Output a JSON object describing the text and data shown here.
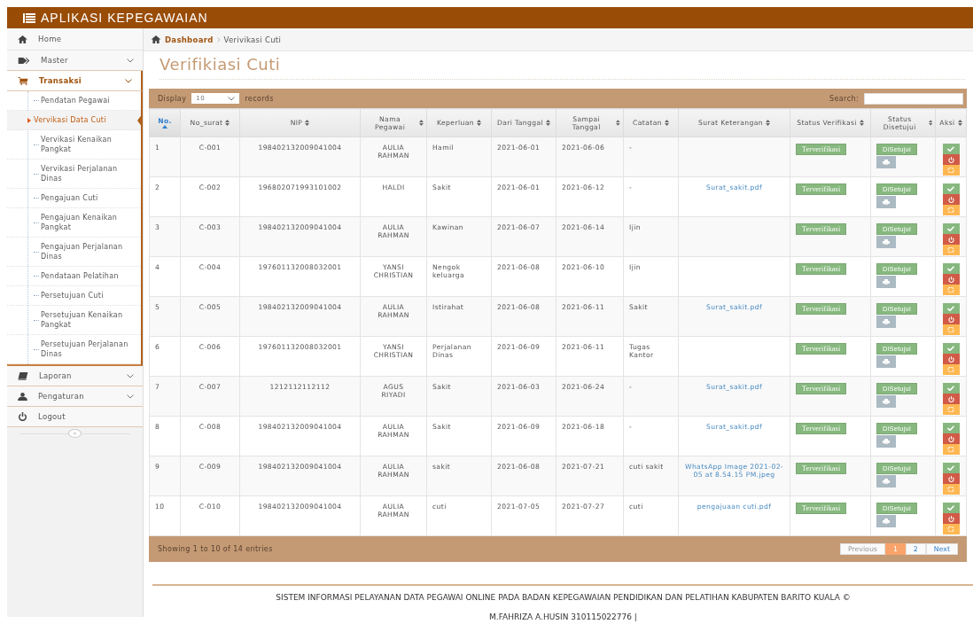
{
  "header": {
    "title": "APLIKASI KEPEGAWAIAN"
  },
  "sidebar": {
    "items": [
      {
        "label": "Home",
        "kind": "link"
      },
      {
        "label": "Master",
        "kind": "menu",
        "expanded": false
      },
      {
        "label": "Transaksi",
        "kind": "menu",
        "expanded": true,
        "children": [
          {
            "label": "Pendatan Pegawai",
            "selected": false
          },
          {
            "label": "Vervikasi Data Cuti",
            "selected": true
          },
          {
            "label": "Vervikasi Kenaikan Pangkat",
            "selected": false
          },
          {
            "label": "Vervikasi Perjalanan Dinas",
            "selected": false
          },
          {
            "label": "Pengajuan Cuti",
            "selected": false
          },
          {
            "label": "Pengajuan Kenaikan Pangkat",
            "selected": false
          },
          {
            "label": "Pengajuan Perjalanan Dinas",
            "selected": false
          },
          {
            "label": "Pendataan Pelatihan",
            "selected": false
          },
          {
            "label": "Persetujuan Cuti",
            "selected": false
          },
          {
            "label": "Persetujuan Kenaikan Pangkat",
            "selected": false
          },
          {
            "label": "Persetujuan Perjalanan Dinas",
            "selected": false
          }
        ]
      },
      {
        "label": "Laporan",
        "kind": "menu",
        "expanded": false
      },
      {
        "label": "Pengaturan",
        "kind": "menu",
        "expanded": false
      },
      {
        "label": "Logout",
        "kind": "link"
      }
    ],
    "collapse_button": "«"
  },
  "breadcrumb": [
    {
      "label": "Dashboard",
      "kind": "link"
    },
    {
      "label": "Verivikasi Cuti",
      "kind": "current"
    }
  ],
  "page_title": "Verifikiasi Cuti",
  "table": {
    "length_label": "Display",
    "length_value": "10",
    "length_suffix": "records",
    "search_label": "Search:",
    "columns": [
      {
        "label": "No.",
        "sorted": true
      },
      {
        "label": "No_surat",
        "sorted": false
      },
      {
        "label": "NIP",
        "sorted": false
      },
      {
        "label": "Nama Pegawai",
        "sorted": false
      },
      {
        "label": "Keperluan",
        "sorted": false
      },
      {
        "label": "Dari Tanggal",
        "sorted": false
      },
      {
        "label": "Sampai Tanggal",
        "sorted": false
      },
      {
        "label": "Catatan",
        "sorted": false
      },
      {
        "label": "Surat Keterangan",
        "sorted": false
      },
      {
        "label": "Status Verifikasi",
        "sorted": false
      },
      {
        "label": "Status Disetujui",
        "sorted": false
      },
      {
        "label": "Aksi",
        "sorted": false
      }
    ],
    "rows": [
      {
        "no": "1",
        "no_surat": "C-001",
        "nip": "198402132009041004",
        "nama": "AULIA RAHMAN",
        "keperluan": "Hamil",
        "dari": "2021-06-01",
        "sampai": "2021-06-06",
        "catatan": "-",
        "status_verifikasi": "Terverifikasi",
        "status_disetujui": "DiSetujui"
      },
      {
        "no": "2",
        "no_surat": "C-002",
        "nip": "196802071993101002",
        "nama": "HALDI",
        "keperluan": "Sakit",
        "dari": "2021-06-01",
        "sampai": "2021-06-12",
        "catatan": "-",
        "surat": "Surat_sakit.pdf",
        "status_verifikasi": "Terverifikasi",
        "status_disetujui": "DiSetujui"
      },
      {
        "no": "3",
        "no_surat": "C-003",
        "nip": "198402132009041004",
        "nama": "AULIA RAHMAN",
        "keperluan": "Kawinan",
        "dari": "2021-06-07",
        "sampai": "2021-06-14",
        "catatan": "Ijin",
        "status_verifikasi": "Terverifikasi",
        "status_disetujui": "DiSetujui"
      },
      {
        "no": "4",
        "no_surat": "C-004",
        "nip": "197601132008032001",
        "nama": "YANSI CHRISTIAN",
        "keperluan": "Nengok keluarga",
        "dari": "2021-06-08",
        "sampai": "2021-06-10",
        "catatan": "Ijin",
        "status_verifikasi": "Terverifikasi",
        "status_disetujui": "DiSetujui"
      },
      {
        "no": "5",
        "no_surat": "C-005",
        "nip": "198402132009041004",
        "nama": "AULIA RAHMAN",
        "keperluan": "Istirahat",
        "dari": "2021-06-08",
        "sampai": "2021-06-11",
        "catatan": "Sakit",
        "surat": "Surat_sakit.pdf",
        "status_verifikasi": "Terverifikasi",
        "status_disetujui": "DiSetujui"
      },
      {
        "no": "6",
        "no_surat": "C-006",
        "nip": "197601132008032001",
        "nama": "YANSI CHRISTIAN",
        "keperluan": "Perjalanan Dinas",
        "dari": "2021-06-09",
        "sampai": "2021-06-11",
        "catatan": "Tugas Kantor",
        "status_verifikasi": "Terverifikasi",
        "status_disetujui": "DiSetujui"
      },
      {
        "no": "7",
        "no_surat": "C-007",
        "nip": "1212112112112",
        "nama": "AGUS RIYADI",
        "keperluan": "Sakit",
        "dari": "2021-06-03",
        "sampai": "2021-06-24",
        "catatan": "-",
        "surat": "Surat_sakit.pdf",
        "status_verifikasi": "Terverifikasi",
        "status_disetujui": "DiSetujui"
      },
      {
        "no": "8",
        "no_surat": "C-008",
        "nip": "198402132009041004",
        "nama": "AULIA RAHMAN",
        "keperluan": "Sakit",
        "dari": "2021-06-09",
        "sampai": "2021-06-18",
        "catatan": "-",
        "surat": "Surat_sakit.pdf",
        "status_verifikasi": "Terverifikasi",
        "status_disetujui": "DiSetujui"
      },
      {
        "no": "9",
        "no_surat": "C-009",
        "nip": "198402132009041004",
        "nama": "AULIA RAHMAN",
        "keperluan": "sakit",
        "dari": "2021-06-08",
        "sampai": "2021-07-21",
        "catatan": "cuti sakit",
        "surat": "WhatsApp Image 2021-02-05 at 8.54.15 PM.jpeg",
        "status_verifikasi": "Terverifikasi",
        "status_disetujui": "DiSetujui"
      },
      {
        "no": "10",
        "no_surat": "C-010",
        "nip": "198402132009041004",
        "nama": "AULIA RAHMAN",
        "keperluan": "cuti",
        "dari": "2021-07-05",
        "sampai": "2021-07-27",
        "catatan": "cuti",
        "surat": "pengajuaan cuti.pdf",
        "status_verifikasi": "Terverifikasi",
        "status_disetujui": "DiSetujui"
      }
    ],
    "info": "Showing 1 to 10 of 14 entries",
    "pages": [
      {
        "label": "Previous",
        "selected": false,
        "disabled": true
      },
      {
        "label": "1",
        "selected": true,
        "disabled": false
      },
      {
        "label": "2",
        "selected": false,
        "disabled": false
      },
      {
        "label": "Next",
        "selected": false,
        "disabled": false
      }
    ]
  },
  "footer": {
    "lines": [
      "SISTEM INFORMASI PELAYANAN DATA PEGAWAI ONLINE PADA BADAN KEPEGAWAIAN PENDIDIKAN DAN PELATIHAN KABUPATEN BARITO KUALA ©",
      "M.FAHRIZA A.HUSIN 310115022776 |"
    ]
  }
}
